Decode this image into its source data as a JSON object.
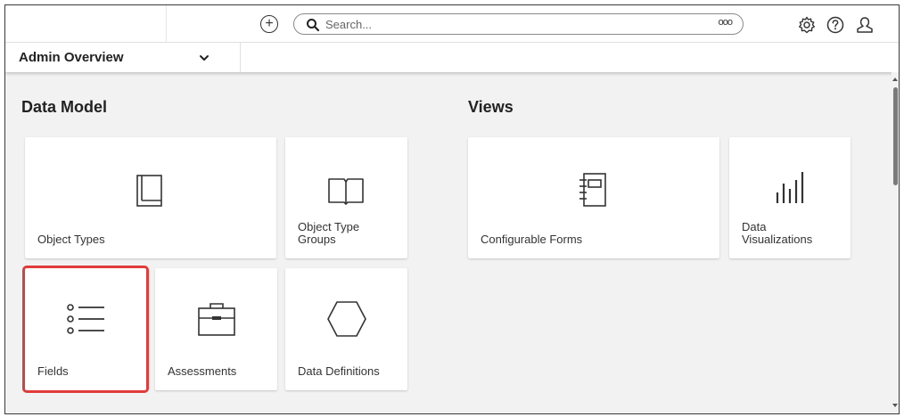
{
  "topbar": {
    "search_placeholder": "Search...",
    "search_options_glyph": "ooo",
    "add_icon": "plus-circle-icon",
    "settings_icon": "gear-icon",
    "help_icon": "question-circle-icon",
    "user_icon": "user-icon"
  },
  "subbar": {
    "view_label": "Admin Overview"
  },
  "sections": {
    "data_model_title": "Data Model",
    "views_title": "Views"
  },
  "tiles": {
    "object_types": "Object Types",
    "object_type_groups_line1": "Object Type",
    "object_type_groups_line2": "Groups",
    "fields": "Fields",
    "assessments": "Assessments",
    "data_definitions": "Data Definitions",
    "configurable_forms": "Configurable Forms",
    "data_visualizations_line1": "Data",
    "data_visualizations_line2": "Visualizations"
  },
  "colors": {
    "highlight": "#e23b3b",
    "background": "#f2f2f2",
    "tile": "#ffffff"
  }
}
